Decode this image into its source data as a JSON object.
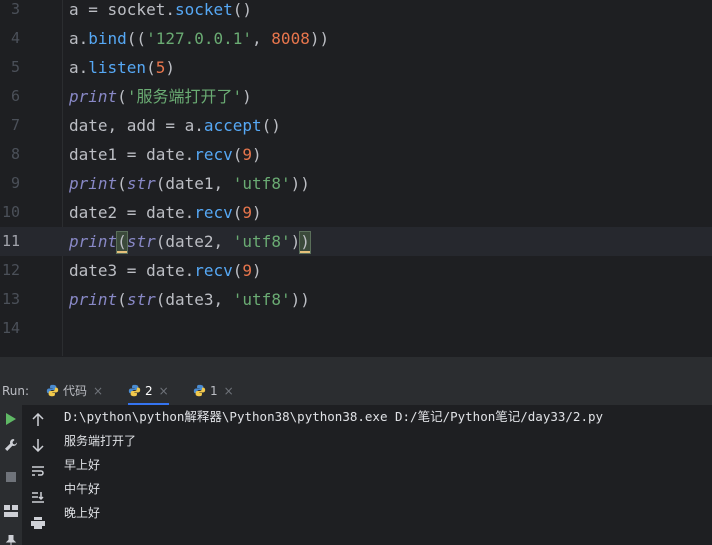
{
  "editor": {
    "lines": [
      {
        "num": "3",
        "parts": [
          [
            "a = ",
            ""
          ],
          [
            "socket",
            ""
          ],
          [
            ".",
            ""
          ],
          [
            "socket",
            "fn"
          ],
          [
            "()",
            "br"
          ]
        ]
      },
      {
        "num": "4",
        "parts": [
          [
            "a.",
            ""
          ],
          [
            "bind",
            "fn"
          ],
          [
            "((",
            "br"
          ],
          [
            "'127.0.0.1'",
            "str"
          ],
          [
            ", ",
            ""
          ],
          [
            "8008",
            "num2"
          ],
          [
            "))",
            "br"
          ]
        ]
      },
      {
        "num": "5",
        "parts": [
          [
            "a.",
            ""
          ],
          [
            "listen",
            "fn"
          ],
          [
            "(",
            "br"
          ],
          [
            "5",
            "num2"
          ],
          [
            ")",
            "br"
          ]
        ]
      },
      {
        "num": "6",
        "parts": [
          [
            "print",
            "bi"
          ],
          [
            "(",
            "br"
          ],
          [
            "'服务端打开了'",
            "str"
          ],
          [
            ")",
            "br"
          ]
        ]
      },
      {
        "num": "7",
        "parts": [
          [
            "date, add = a.",
            ""
          ],
          [
            "accept",
            "fn"
          ],
          [
            "()",
            "br"
          ]
        ]
      },
      {
        "num": "8",
        "parts": [
          [
            "date1 = date.",
            ""
          ],
          [
            "recv",
            "fn"
          ],
          [
            "(",
            "br"
          ],
          [
            "9",
            "num2"
          ],
          [
            ")",
            "br"
          ]
        ]
      },
      {
        "num": "9",
        "parts": [
          [
            "print",
            "bi"
          ],
          [
            "(",
            "br"
          ],
          [
            "str",
            "bi"
          ],
          [
            "(date1, ",
            ""
          ],
          [
            "'utf8'",
            "str"
          ],
          [
            "))",
            "br"
          ]
        ]
      },
      {
        "num": "10",
        "parts": [
          [
            "date2 = date.",
            ""
          ],
          [
            "recv",
            "fn"
          ],
          [
            "(",
            "br"
          ],
          [
            "9",
            "num2"
          ],
          [
            ")",
            "br"
          ]
        ]
      },
      {
        "num": "11",
        "parts": [
          [
            "print",
            "bi"
          ],
          [
            "(",
            "match"
          ],
          [
            "str",
            "bi"
          ],
          [
            "(date2, ",
            ""
          ],
          [
            "'utf8'",
            "str"
          ],
          [
            ")",
            "br"
          ],
          [
            ")",
            "match"
          ]
        ]
      },
      {
        "num": "12",
        "parts": [
          [
            "date3 = date.",
            ""
          ],
          [
            "recv",
            "fn"
          ],
          [
            "(",
            "br"
          ],
          [
            "9",
            "num2"
          ],
          [
            ")",
            "br"
          ]
        ]
      },
      {
        "num": "13",
        "parts": [
          [
            "print",
            "bi"
          ],
          [
            "(",
            "br"
          ],
          [
            "str",
            "bi"
          ],
          [
            "(date3, ",
            ""
          ],
          [
            "'utf8'",
            "str"
          ],
          [
            "))",
            "br"
          ]
        ]
      },
      {
        "num": "14",
        "parts": []
      }
    ],
    "current_line": "11"
  },
  "run": {
    "label": "Run:",
    "tabs": [
      {
        "label": "代码",
        "active": false
      },
      {
        "label": "2",
        "active": true
      },
      {
        "label": "1",
        "active": false
      }
    ],
    "close_glyph": "×"
  },
  "console": {
    "command": "D:\\python\\python解释器\\Python38\\python38.exe D:/笔记/Python笔记/day33/2.py",
    "output": [
      "服务端打开了",
      "早上好",
      "中午好",
      "晚上好"
    ]
  },
  "colors": {
    "editor_bg": "#1e1f22",
    "panel_bg": "#2b2d30",
    "accent": "#3574f0",
    "run_green": "#5fb865"
  }
}
